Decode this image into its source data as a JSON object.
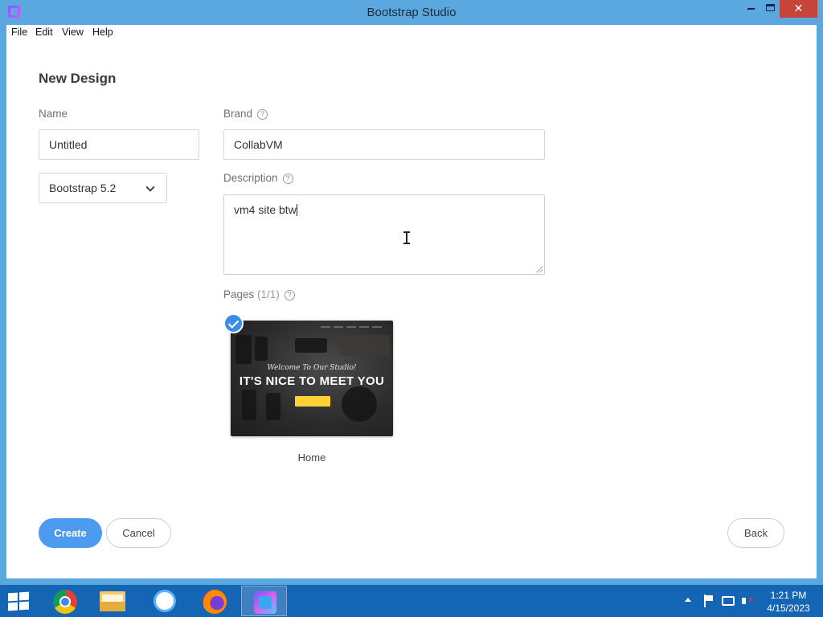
{
  "window": {
    "title": "Bootstrap Studio"
  },
  "menu": {
    "file": "File",
    "edit": "Edit",
    "view": "View",
    "help": "Help"
  },
  "dialog": {
    "heading": "New Design",
    "name_label": "Name",
    "name_value": "Untitled",
    "framework_value": "Bootstrap 5.2",
    "brand_label": "Brand",
    "brand_value": "CollabVM",
    "description_label": "Description",
    "description_value": "vm4 site btw",
    "pages_label": "Pages",
    "pages_count": "(1/1)",
    "help_glyph": "?",
    "page": {
      "name": "Home",
      "thumb_welcome": "Welcome To Our Studio!",
      "thumb_headline": "IT'S NICE TO MEET YOU",
      "selected": true
    },
    "create_label": "Create",
    "cancel_label": "Cancel",
    "back_label": "Back"
  },
  "taskbar": {
    "items": [
      "chrome-icon",
      "file-explorer-icon",
      "settings-sun-icon",
      "firefox-icon",
      "bootstrap-studio-icon"
    ],
    "active_item": "bootstrap-studio-icon",
    "time": "1:21 PM",
    "date": "4/15/2023"
  },
  "colors": {
    "accent": "#4c9bf0",
    "titlebar": "#5ba8e0",
    "close": "#c7443b",
    "taskbar": "#1565b5"
  }
}
